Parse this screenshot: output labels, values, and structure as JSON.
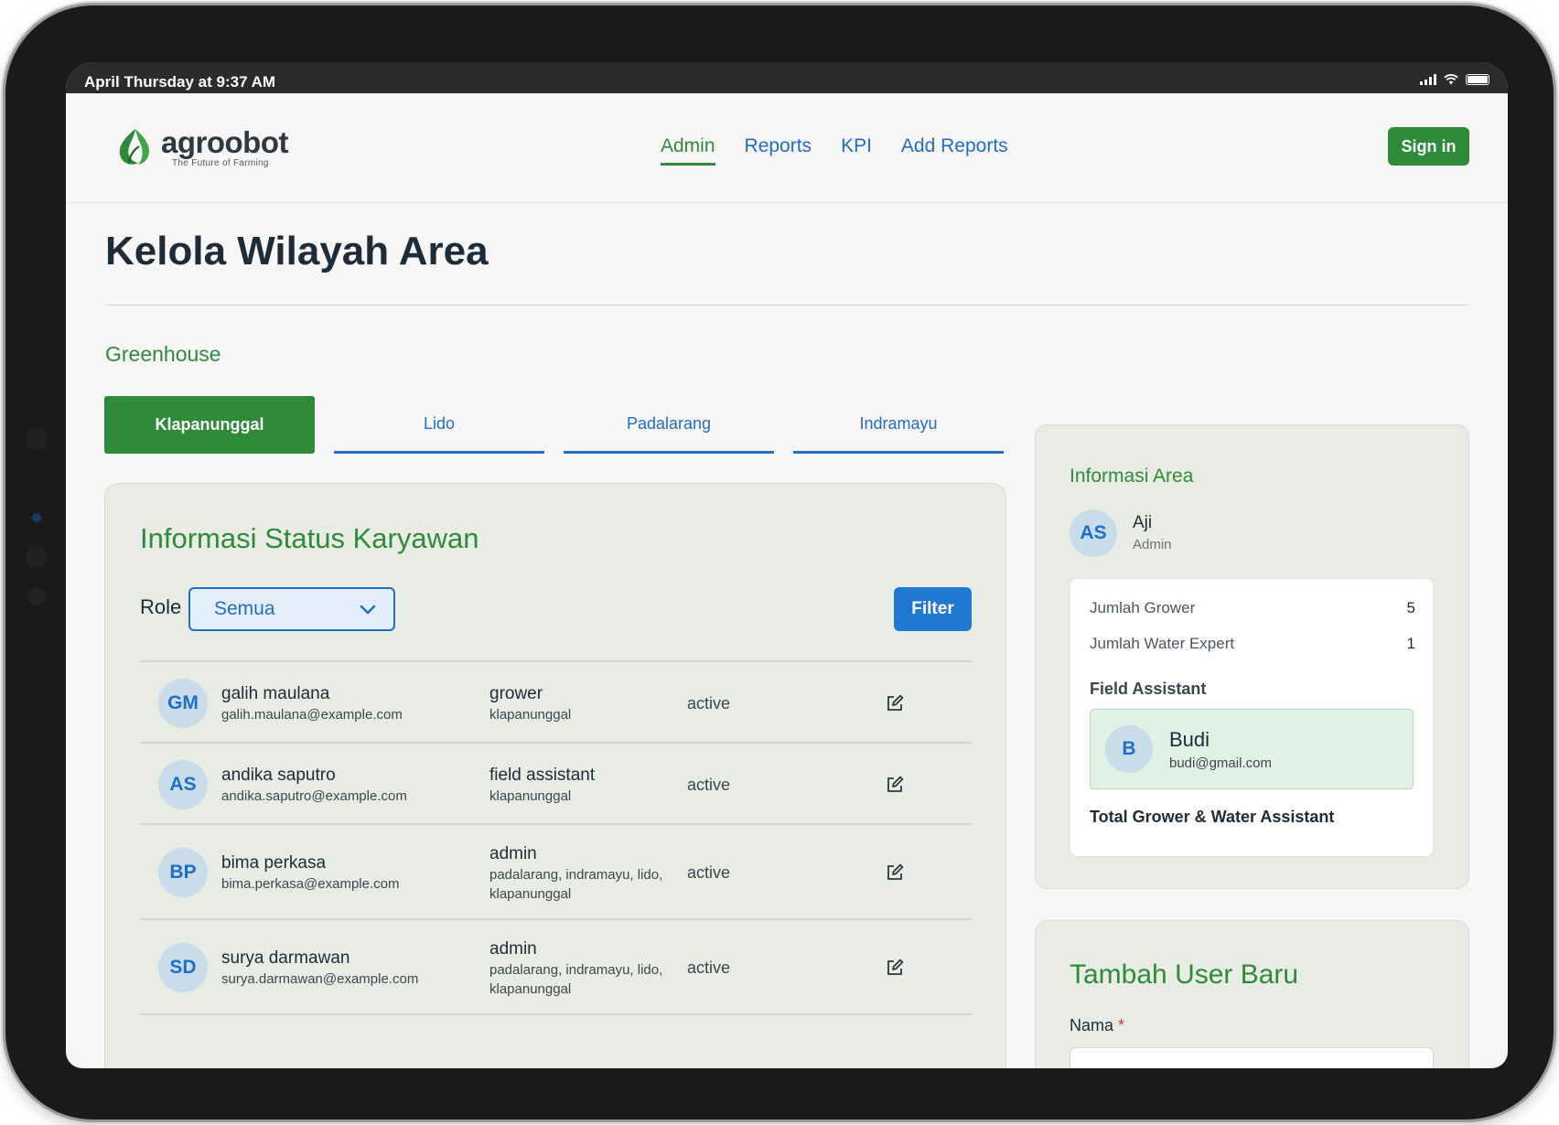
{
  "statusbar": {
    "time": "April Thursday at 9:37 AM"
  },
  "brand": {
    "name": "agroobot",
    "tagline": "The Future of Farming"
  },
  "nav": {
    "items": [
      {
        "label": "Admin",
        "active": true
      },
      {
        "label": "Reports",
        "active": false
      },
      {
        "label": "KPI",
        "active": false
      },
      {
        "label": "Add Reports",
        "active": false
      }
    ],
    "signin_label": "Sign in"
  },
  "page": {
    "title": "Kelola Wilayah Area",
    "section": "Greenhouse"
  },
  "tabs": [
    {
      "label": "Klapanunggal",
      "active": true
    },
    {
      "label": "Lido",
      "active": false
    },
    {
      "label": "Padalarang",
      "active": false
    },
    {
      "label": "Indramayu",
      "active": false
    }
  ],
  "employees": {
    "title": "Informasi Status Karyawan",
    "role_label": "Role",
    "role_value": "Semua",
    "filter_label": "Filter",
    "rows": [
      {
        "initials": "GM",
        "name": "galih maulana",
        "email": "galih.maulana@example.com",
        "role": "grower",
        "area": "klapanunggal",
        "status": "active"
      },
      {
        "initials": "AS",
        "name": "andika saputro",
        "email": "andika.saputro@example.com",
        "role": "field assistant",
        "area": "klapanunggal",
        "status": "active"
      },
      {
        "initials": "BP",
        "name": "bima perkasa",
        "email": "bima.perkasa@example.com",
        "role": "admin",
        "area": "padalarang, indramayu, lido, klapanunggal",
        "status": "active"
      },
      {
        "initials": "SD",
        "name": "surya darmawan",
        "email": "surya.darmawan@example.com",
        "role": "admin",
        "area": "padalarang, indramayu, lido, klapanunggal",
        "status": "active"
      }
    ]
  },
  "info_area": {
    "title": "Informasi Area",
    "admin": {
      "initials": "AS",
      "name": "Aji",
      "role": "Admin"
    },
    "jumlah_grower_label": "Jumlah Grower",
    "jumlah_grower": "5",
    "jumlah_water_label": "Jumlah Water Expert",
    "jumlah_water": "1",
    "field_assistant_label": "Field Assistant",
    "field_assistant": {
      "initials": "B",
      "name": "Budi",
      "email": "budi@gmail.com"
    },
    "total_label": "Total Grower & Water Assistant"
  },
  "add_user": {
    "title": "Tambah User Baru",
    "nama_label": "Nama",
    "required_mark": "*"
  },
  "colors": {
    "brand_green": "#2e8b3a",
    "link_blue": "#1f6fc4",
    "card_bg": "#e9ece4"
  }
}
